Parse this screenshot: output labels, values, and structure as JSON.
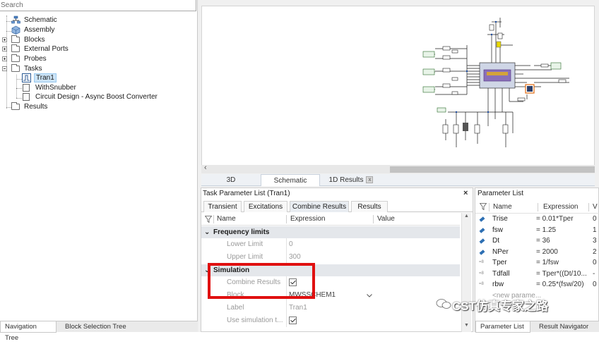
{
  "search": {
    "placeholder": "Search"
  },
  "tree": {
    "items": [
      {
        "label": "Schematic"
      },
      {
        "label": "Assembly"
      },
      {
        "label": "Blocks"
      },
      {
        "label": "External Ports"
      },
      {
        "label": "Probes"
      },
      {
        "label": "Tasks"
      },
      {
        "label": "Tran1",
        "selected": true
      },
      {
        "label": "WithSnubber"
      },
      {
        "label": "Circuit Design - Async Boost Converter"
      },
      {
        "label": "Results"
      }
    ]
  },
  "left_tabs": [
    "Navigation Tree",
    "Block Selection Tree"
  ],
  "view_tabs": [
    "3D",
    "Schematic",
    "1D Results"
  ],
  "view_tab_close": "x",
  "task_panel": {
    "title": "Task Parameter List (Tran1)",
    "close": "×",
    "tabs": [
      "Transient",
      "Excitations",
      "Combine Results",
      "Results"
    ],
    "columns": [
      "Name",
      "Expression",
      "Value"
    ],
    "sections": [
      {
        "label": "Frequency limits",
        "rows": [
          {
            "name": "Lower Limit",
            "expression": "0"
          },
          {
            "name": "Upper Limit",
            "expression": "300"
          }
        ]
      },
      {
        "label": "Simulation",
        "rows": [
          {
            "name": "Combine Results",
            "checked": true
          },
          {
            "name": "Block",
            "expression": "MWSSCHEM1"
          },
          {
            "name": "Label",
            "expression": "Tran1"
          },
          {
            "name": "Use simulation t...",
            "checked": true
          }
        ]
      }
    ]
  },
  "param_list": {
    "title": "Parameter List",
    "columns": [
      "Name",
      "Expression",
      "V"
    ],
    "rows": [
      {
        "name": "Trise",
        "expression": "= 0.01*Tper",
        "value": "0"
      },
      {
        "name": "fsw",
        "expression": "= 1.25",
        "value": "1"
      },
      {
        "name": "Dt",
        "expression": "= 36",
        "value": "3"
      },
      {
        "name": "NPer",
        "expression": "= 2000",
        "value": "2"
      },
      {
        "name": "Tper",
        "expression": "= 1/fsw",
        "value": "0"
      },
      {
        "name": "Tdfall",
        "expression": "= Tper*((Dt/10...",
        "value": "-"
      },
      {
        "name": "rbw",
        "expression": "= 0.25*(fsw/20)",
        "value": "0"
      }
    ],
    "new_param_placeholder": "<new parame...",
    "bottom_tabs": [
      "Parameter List",
      "Result Navigator"
    ]
  },
  "watermark": "CST仿真专家之路",
  "colors": {
    "selection": "#cce4f7",
    "highlight": "#e01010",
    "pin": "#2d6fb3"
  }
}
